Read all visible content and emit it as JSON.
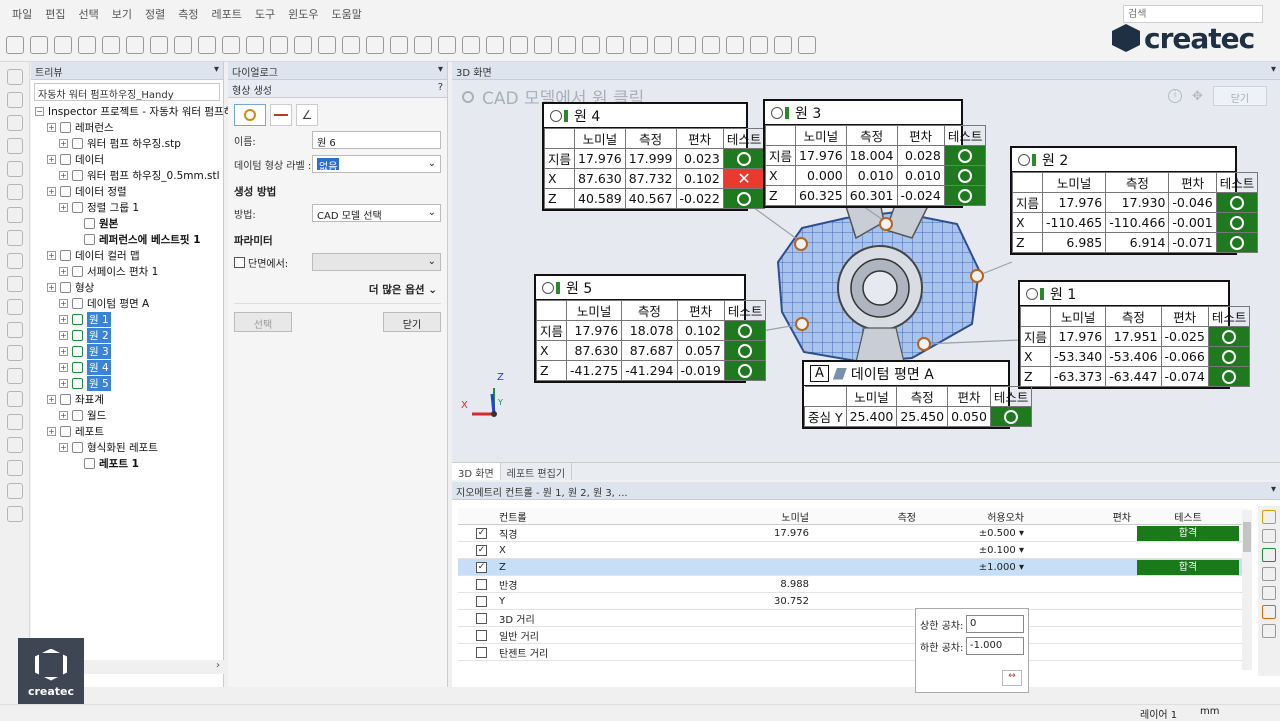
{
  "menu": [
    "파일",
    "편집",
    "선택",
    "보기",
    "정렬",
    "측정",
    "레포트",
    "도구",
    "윈도우",
    "도움말"
  ],
  "search": {
    "placeholder": "검색"
  },
  "brand": {
    "logo": "createc",
    "video_logo": "createc"
  },
  "toolbar_icons": [
    "new-icon",
    "open-icon",
    "save-icon",
    "undo-icon",
    "redo-icon",
    "forward-icon",
    "settings-icon",
    "align-icon",
    "scan-icon",
    "grid-icon",
    "mesh-icon",
    "probe-icon",
    "box-icon",
    "point-icon",
    "curve-icon",
    "line-icon",
    "measure-icon",
    "zoom-icon",
    "view-icon",
    "section-icon",
    "chart-icon",
    "text-icon",
    "report-icon",
    "camera-icon",
    "table-icon",
    "snapshot-icon",
    "feature-icon",
    "plot-icon",
    "deviation-icon",
    "compare-icon",
    "tools-icon",
    "export-icon",
    "brush-icon",
    "import-icon"
  ],
  "tree": {
    "title": "트리뷰",
    "project_field": "자동차 워터 펌프하우징_Handy",
    "root": "Inspector 프로젝트 - 자동차 워터 펌프하",
    "items": [
      {
        "label": "레퍼런스",
        "indent": 1
      },
      {
        "label": "워터 펌프 하우징.stp",
        "indent": 2
      },
      {
        "label": "데이터",
        "indent": 1
      },
      {
        "label": "워터 펌프 하우징_0.5mm.stl",
        "indent": 2
      },
      {
        "label": "데이터 정렬",
        "indent": 1
      },
      {
        "label": "정렬 그룹 1",
        "indent": 2
      },
      {
        "label": "원본",
        "indent": 3
      },
      {
        "label": "레퍼런스에 베스트핏 1",
        "indent": 3
      },
      {
        "label": "데이터 컬러 맵",
        "indent": 1
      },
      {
        "label": "서페이스 편차 1",
        "indent": 2
      },
      {
        "label": "형상",
        "indent": 1
      },
      {
        "label": "데이텀 평면 A",
        "indent": 2
      },
      {
        "label": "원 1",
        "indent": 2
      },
      {
        "label": "원 2",
        "indent": 2
      },
      {
        "label": "원 3",
        "indent": 2
      },
      {
        "label": "원 4",
        "indent": 2
      },
      {
        "label": "원 5",
        "indent": 2
      },
      {
        "label": "좌표계",
        "indent": 1
      },
      {
        "label": "월드",
        "indent": 2
      },
      {
        "label": "레포트",
        "indent": 1
      },
      {
        "label": "형식화된 레포트",
        "indent": 2
      },
      {
        "label": "레포트 1",
        "indent": 3
      }
    ]
  },
  "dialog": {
    "title": "다이얼로그",
    "section": "형상 생성",
    "help": "?",
    "name_label": "이름:",
    "name_value": "원 6",
    "datum_label": "데이텀 형상 라벨 :",
    "datum_value": "없음",
    "method_title": "생성 방법",
    "method_label": "방법:",
    "method_value": "CAD 모델 선택",
    "param_title": "파라미터",
    "section_label": "단면에서:",
    "more_options": "더 많은 옵션",
    "select_button": "선택",
    "close_button": "닫기"
  },
  "view3d": {
    "title": "3D 화면",
    "prompt": "CAD 모델에서 원 클릭",
    "close": "닫기",
    "axis_x": "X",
    "axis_z": "Z",
    "axis_y": "Y"
  },
  "callouts": {
    "headers": [
      "노미널",
      "측정",
      "편차",
      "테스트"
    ],
    "circle4": {
      "title": "원 4",
      "rows": [
        {
          "axis": "지름",
          "nominal": "17.976",
          "measured": "17.999",
          "dev": "0.023",
          "test": "pass"
        },
        {
          "axis": "X",
          "nominal": "87.630",
          "measured": "87.732",
          "dev": "0.102",
          "test": "fail"
        },
        {
          "axis": "Z",
          "nominal": "40.589",
          "measured": "40.567",
          "dev": "-0.022",
          "test": "pass"
        }
      ]
    },
    "circle3": {
      "title": "원 3",
      "rows": [
        {
          "axis": "지름",
          "nominal": "17.976",
          "measured": "18.004",
          "dev": "0.028",
          "test": "pass"
        },
        {
          "axis": "X",
          "nominal": "0.000",
          "measured": "0.010",
          "dev": "0.010",
          "test": "pass"
        },
        {
          "axis": "Z",
          "nominal": "60.325",
          "measured": "60.301",
          "dev": "-0.024",
          "test": "pass"
        }
      ]
    },
    "circle2": {
      "title": "원 2",
      "rows": [
        {
          "axis": "지름",
          "nominal": "17.976",
          "measured": "17.930",
          "dev": "-0.046",
          "test": "pass"
        },
        {
          "axis": "X",
          "nominal": "-110.465",
          "measured": "-110.466",
          "dev": "-0.001",
          "test": "pass"
        },
        {
          "axis": "Z",
          "nominal": "6.985",
          "measured": "6.914",
          "dev": "-0.071",
          "test": "pass"
        }
      ]
    },
    "circle5": {
      "title": "원 5",
      "rows": [
        {
          "axis": "지름",
          "nominal": "17.976",
          "measured": "18.078",
          "dev": "0.102",
          "test": "pass"
        },
        {
          "axis": "X",
          "nominal": "87.630",
          "measured": "87.687",
          "dev": "0.057",
          "test": "pass"
        },
        {
          "axis": "Z",
          "nominal": "-41.275",
          "measured": "-41.294",
          "dev": "-0.019",
          "test": "pass"
        }
      ]
    },
    "circle1": {
      "title": "원 1",
      "rows": [
        {
          "axis": "지름",
          "nominal": "17.976",
          "measured": "17.951",
          "dev": "-0.025",
          "test": "pass"
        },
        {
          "axis": "X",
          "nominal": "-53.340",
          "measured": "-53.406",
          "dev": "-0.066",
          "test": "pass"
        },
        {
          "axis": "Z",
          "nominal": "-63.373",
          "measured": "-63.447",
          "dev": "-0.074",
          "test": "pass"
        }
      ]
    },
    "datumA": {
      "badge": "A",
      "title": "데이텀 평면 A",
      "headers": [
        "노미널",
        "측정",
        "편차",
        "테스트"
      ],
      "row": {
        "axis": "중심 Y",
        "nominal": "25.400",
        "measured": "25.450",
        "dev": "0.050",
        "test": "pass"
      }
    }
  },
  "bottom_tabs": [
    "3D 화면",
    "레포트 편집기"
  ],
  "control_panel": {
    "title": "지오메트리 컨트롤 - 원 1, 원 2, 원 3, ...",
    "columns": [
      "컨트롤",
      "노미널",
      "측정",
      "허용오차",
      "편차",
      "테스트"
    ],
    "rows": [
      {
        "checked": "✓",
        "label": "직경",
        "nominal": "17.976",
        "measured": "",
        "tol": "±0.500",
        "dev": "",
        "test": "합격",
        "selected": false
      },
      {
        "checked": "✓",
        "label": "X",
        "nominal": "",
        "measured": "",
        "tol": "±0.100",
        "dev": "",
        "test": "",
        "selected": false
      },
      {
        "checked": "✓",
        "label": "Z",
        "nominal": "",
        "measured": "",
        "tol": "±1.000",
        "dev": "",
        "test": "합격",
        "selected": true
      },
      {
        "checked": "",
        "label": "반경",
        "nominal": "8.988",
        "measured": "",
        "tol": "",
        "dev": "",
        "test": "",
        "selected": false
      },
      {
        "checked": "",
        "label": "Y",
        "nominal": "30.752",
        "measured": "",
        "tol": "",
        "dev": "",
        "test": "",
        "selected": false
      },
      {
        "checked": "",
        "label": "3D 거리",
        "nominal": "",
        "measured": "",
        "tol": "",
        "dev": "",
        "test": "",
        "selected": false
      },
      {
        "checked": "",
        "label": "일반 거리",
        "nominal": "",
        "measured": "",
        "tol": "",
        "dev": "",
        "test": "",
        "selected": false
      },
      {
        "checked": "",
        "label": "탄젠트 거리",
        "nominal": "",
        "measured": "",
        "tol": "",
        "dev": "",
        "test": "",
        "selected": false
      }
    ],
    "tol_popup": {
      "upper_label": "상한 공차:",
      "upper_value": "0",
      "lower_label": "하한 공차:",
      "lower_value": "-1.000"
    }
  },
  "status": {
    "layer": "레이어 1",
    "unit": "mm"
  }
}
